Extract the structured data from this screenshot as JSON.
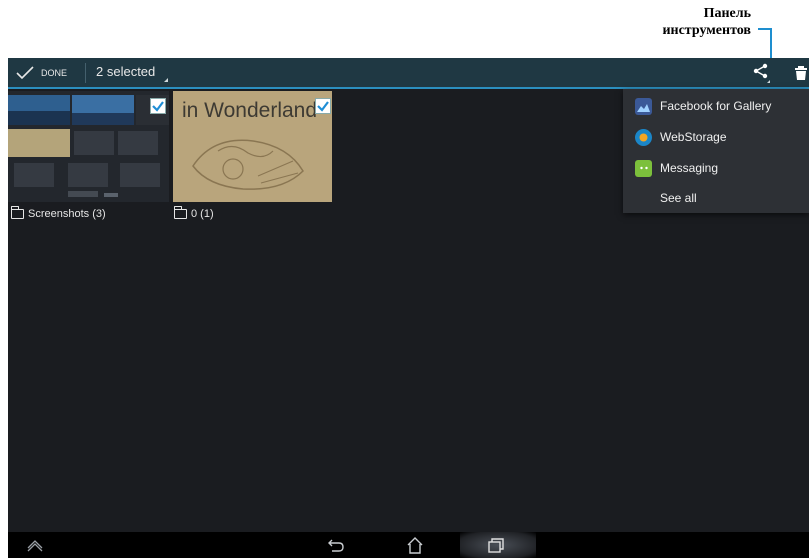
{
  "callout": {
    "line1": "Панель",
    "line2": "инструментов"
  },
  "actionbar": {
    "done_label": "DONE",
    "selected_label": "2 selected",
    "accent_color": "#2b8fbf",
    "icons": [
      "check-icon",
      "share-icon",
      "trash-icon"
    ]
  },
  "albums": [
    {
      "name": "Screenshots (3)",
      "selected": true
    },
    {
      "name": "0 (1)",
      "selected": true,
      "thumbnail_text": "in Wonderland"
    }
  ],
  "share_menu": {
    "items": [
      {
        "label": "Facebook for Gallery",
        "icon": "facebook-gallery-icon"
      },
      {
        "label": "WebStorage",
        "icon": "webstorage-icon"
      },
      {
        "label": "Messaging",
        "icon": "messaging-icon"
      },
      {
        "label": "See all",
        "icon": ""
      }
    ]
  },
  "navbar": {
    "icons": [
      "up-arrow-icon",
      "back-icon",
      "home-icon",
      "recent-apps-icon"
    ]
  }
}
